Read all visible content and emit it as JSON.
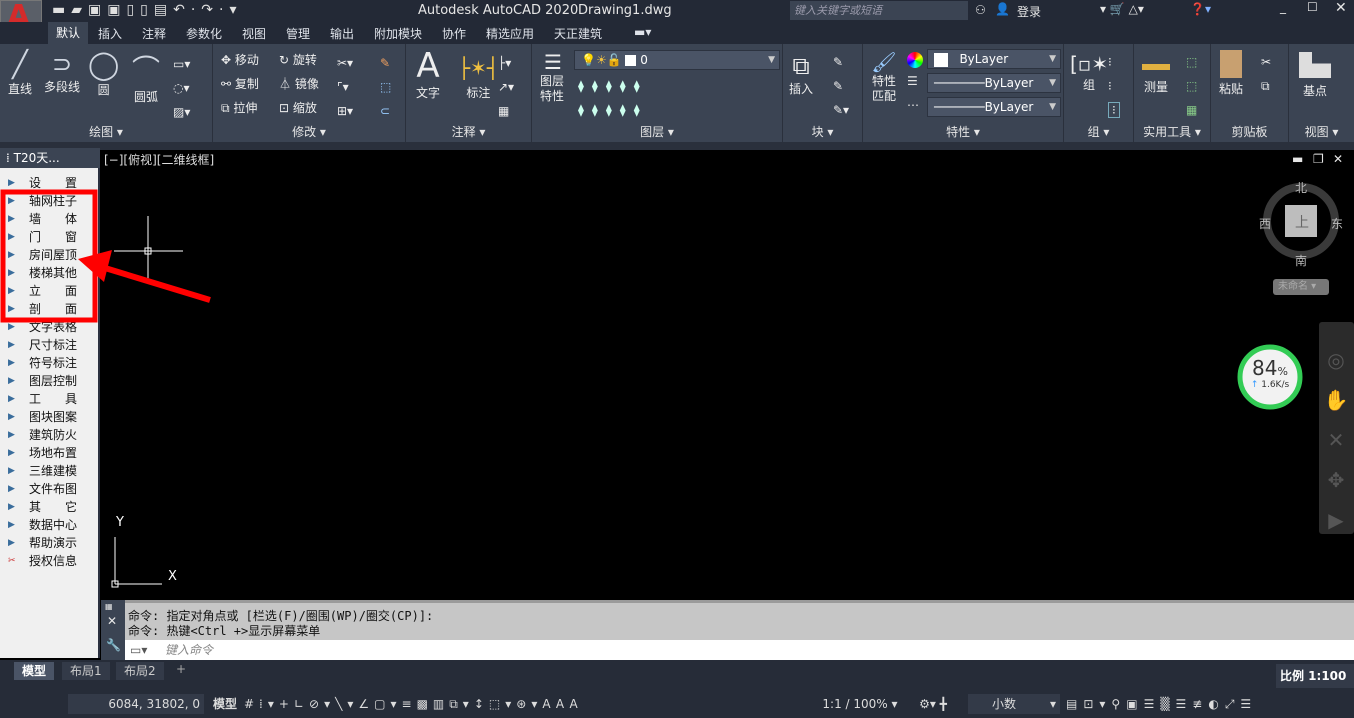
{
  "title": {
    "app": "Autodesk AutoCAD 2020",
    "file": "Drawing1.dwg",
    "search_placeholder": "键入关键字或短语",
    "login": "登录"
  },
  "tabs": [
    "默认",
    "插入",
    "注释",
    "参数化",
    "视图",
    "管理",
    "输出",
    "附加模块",
    "协作",
    "精选应用",
    "天正建筑"
  ],
  "active_tab": "默认",
  "ribbon": {
    "panels": [
      "绘图",
      "修改",
      "注释",
      "图层",
      "块",
      "特性",
      "组",
      "实用工具",
      "剪贴板",
      "视图"
    ],
    "draw": [
      "直线",
      "多段线",
      "圆",
      "圆弧"
    ],
    "modify": [
      "移动",
      "旋转",
      "复制",
      "镜像",
      "拉伸",
      "缩放"
    ],
    "annotate": [
      "文字",
      "标注"
    ],
    "layer": {
      "button": "图层特性",
      "current": "0"
    },
    "block": "插入",
    "properties": {
      "match": "特性匹配",
      "color": "ByLayer",
      "linetype": "ByLayer",
      "lineweight": "ByLayer"
    },
    "group": "组",
    "utilities": "测量",
    "clipboard": "粘贴",
    "view": "基点"
  },
  "palette": {
    "title": "T20天...",
    "items": [
      "设　置",
      "轴网柱子",
      "墙　体",
      "门　窗",
      "房间屋顶",
      "楼梯其他",
      "立　面",
      "剖　面",
      "文字表格",
      "尺寸标注",
      "符号标注",
      "图层控制",
      "工　具",
      "图块图案",
      "建筑防火",
      "场地布置",
      "三维建模",
      "文件布图",
      "其　它",
      "数据中心",
      "帮助演示",
      "授权信息"
    ],
    "highlighted": [
      "轴网柱子",
      "墙　体",
      "门　窗",
      "房间屋顶",
      "楼梯其他",
      "立　面",
      "剖　面"
    ],
    "highlight_color": "#ff0000"
  },
  "viewport": {
    "label": "[−][俯视][二维线框]",
    "viewcube": {
      "north": "北",
      "south": "南",
      "east": "东",
      "west": "西",
      "face": "上",
      "ucs": "未命名"
    },
    "ucs_axis": {
      "x": "X",
      "y": "Y"
    }
  },
  "net_widget": {
    "percent": 84,
    "percent_label": "84",
    "unit": "%",
    "speed": "1.6K/s"
  },
  "command": {
    "history": [
      "命令: 指定对角点或 [栏选(F)/圈围(WP)/圈交(CP)]:",
      "命令: 热键<Ctrl +>显示屏幕菜单"
    ],
    "placeholder": "键入命令"
  },
  "layout_tabs": [
    "模型",
    "布局1",
    "布局2"
  ],
  "status": {
    "coords": "6084, 31802, 0",
    "model": "模型",
    "scale_label": "比例 1:100",
    "annotation_scale": "1:1 / 100%",
    "units": "小数"
  }
}
